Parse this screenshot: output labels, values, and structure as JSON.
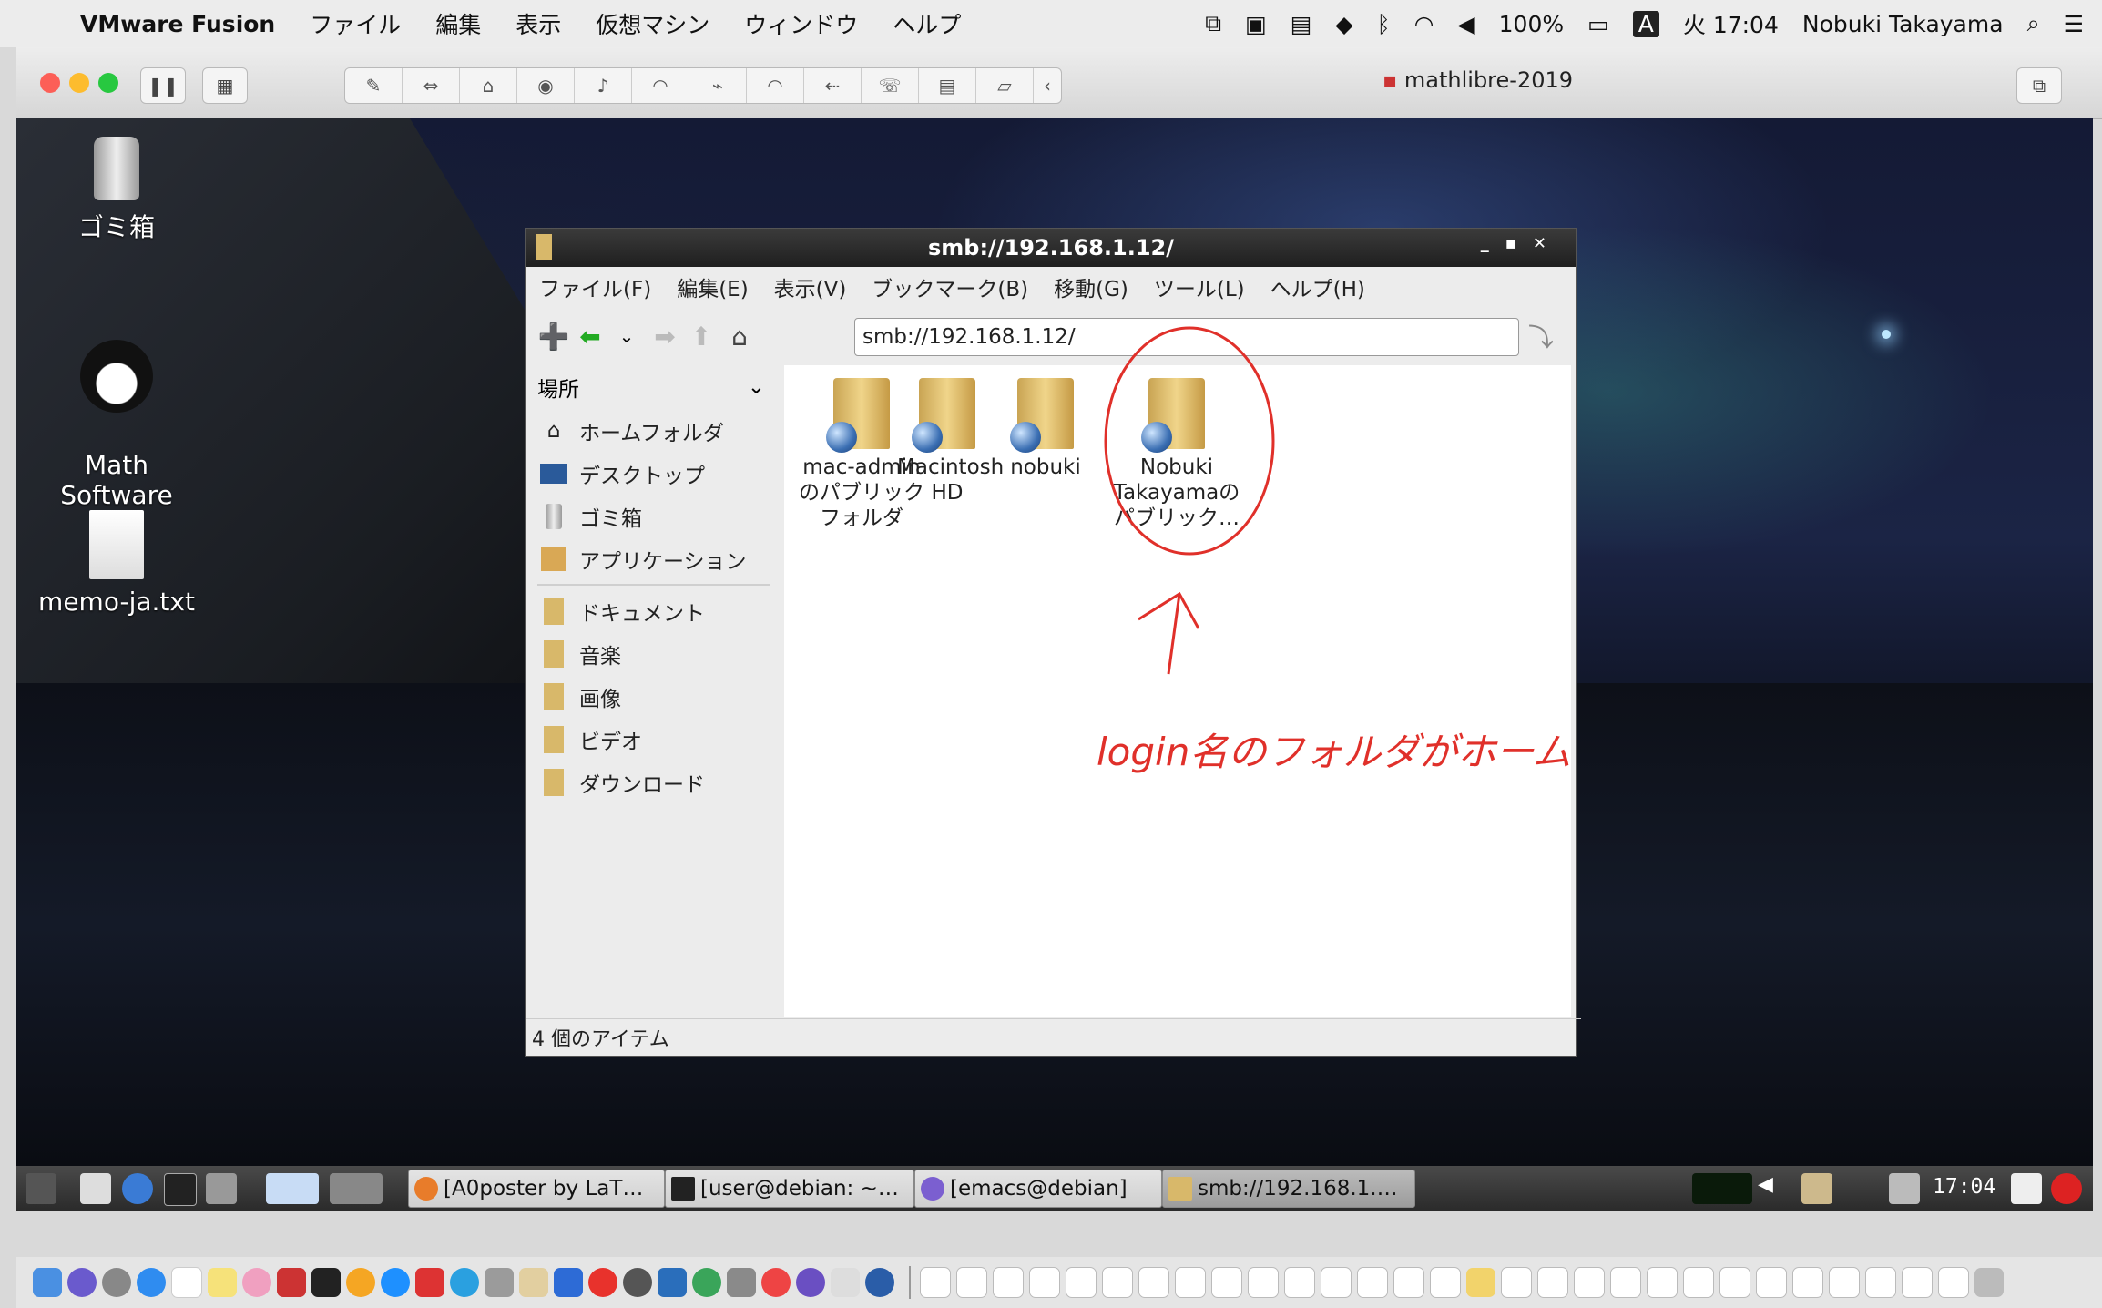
{
  "menubar": {
    "app_name": "VMware Fusion",
    "menus": [
      "ファイル",
      "編集",
      "表示",
      "仮想マシン",
      "ウィンドウ",
      "ヘルプ"
    ],
    "battery": "100%",
    "input_source": "A",
    "datetime": "火 17:04",
    "user": "Nobuki Takayama"
  },
  "vm": {
    "title": "mathlibre-2019"
  },
  "desktop": {
    "icons": [
      {
        "label": "ゴミ箱"
      },
      {
        "label": "Math\nSoftware"
      },
      {
        "label": "memo-ja.txt"
      }
    ]
  },
  "file_manager": {
    "title": "smb://192.168.1.12/",
    "menus": [
      "ファイル(F)",
      "編集(E)",
      "表示(V)",
      "ブックマーク(B)",
      "移動(G)",
      "ツール(L)",
      "ヘルプ(H)"
    ],
    "address": "smb://192.168.1.12/",
    "sidebar_header": "場所",
    "sidebar_places": [
      "ホームフォルダ",
      "デスクトップ",
      "ゴミ箱",
      "アプリケーション"
    ],
    "sidebar_bookmarks": [
      "ドキュメント",
      "音楽",
      "画像",
      "ビデオ",
      "ダウンロード"
    ],
    "files": [
      {
        "name": "mac-adminのパブリックフォルダ"
      },
      {
        "name": "Macintosh HD"
      },
      {
        "name": "nobuki"
      },
      {
        "name": "Nobuki Takayamaのパブリック…"
      }
    ],
    "status": "4 個のアイテム"
  },
  "annotation": {
    "handwritten_note": "login名のフォルダがホーム"
  },
  "panel": {
    "tasks": [
      "[A0poster by LaT…",
      "[user@debian: ~…",
      "[emacs@debian]",
      "smb://192.168.1.…"
    ],
    "clock": "17:04"
  }
}
